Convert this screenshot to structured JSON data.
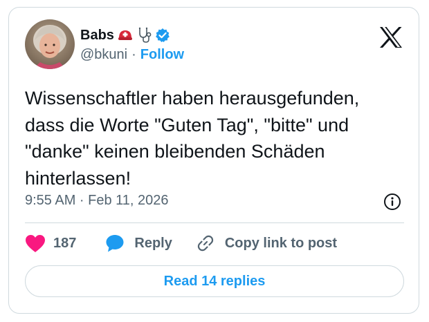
{
  "author": {
    "name": "Babs",
    "handle": "@bkuni",
    "separator": "·",
    "follow_label": "Follow",
    "verified": true,
    "emojis": [
      "helmet-with-white-cross-icon",
      "stethoscope-icon"
    ]
  },
  "tweet": {
    "text": "Wissenschaftler haben herausgefunden,\ndass die Worte \"Guten Tag\", \"bitte\" und\n\"danke\" keinen bleibenden Schäden\nhinterlassen!",
    "timestamp": "9:55 AM · Feb 11, 2026"
  },
  "actions": {
    "like_count": "187",
    "reply_label": "Reply",
    "copy_link_label": "Copy link to post"
  },
  "read_replies_label": "Read 14 replies",
  "colors": {
    "accent": "#1d9bf0",
    "like": "#f91880",
    "text": "#0f1419",
    "muted": "#536471",
    "border": "#cfd9de"
  }
}
